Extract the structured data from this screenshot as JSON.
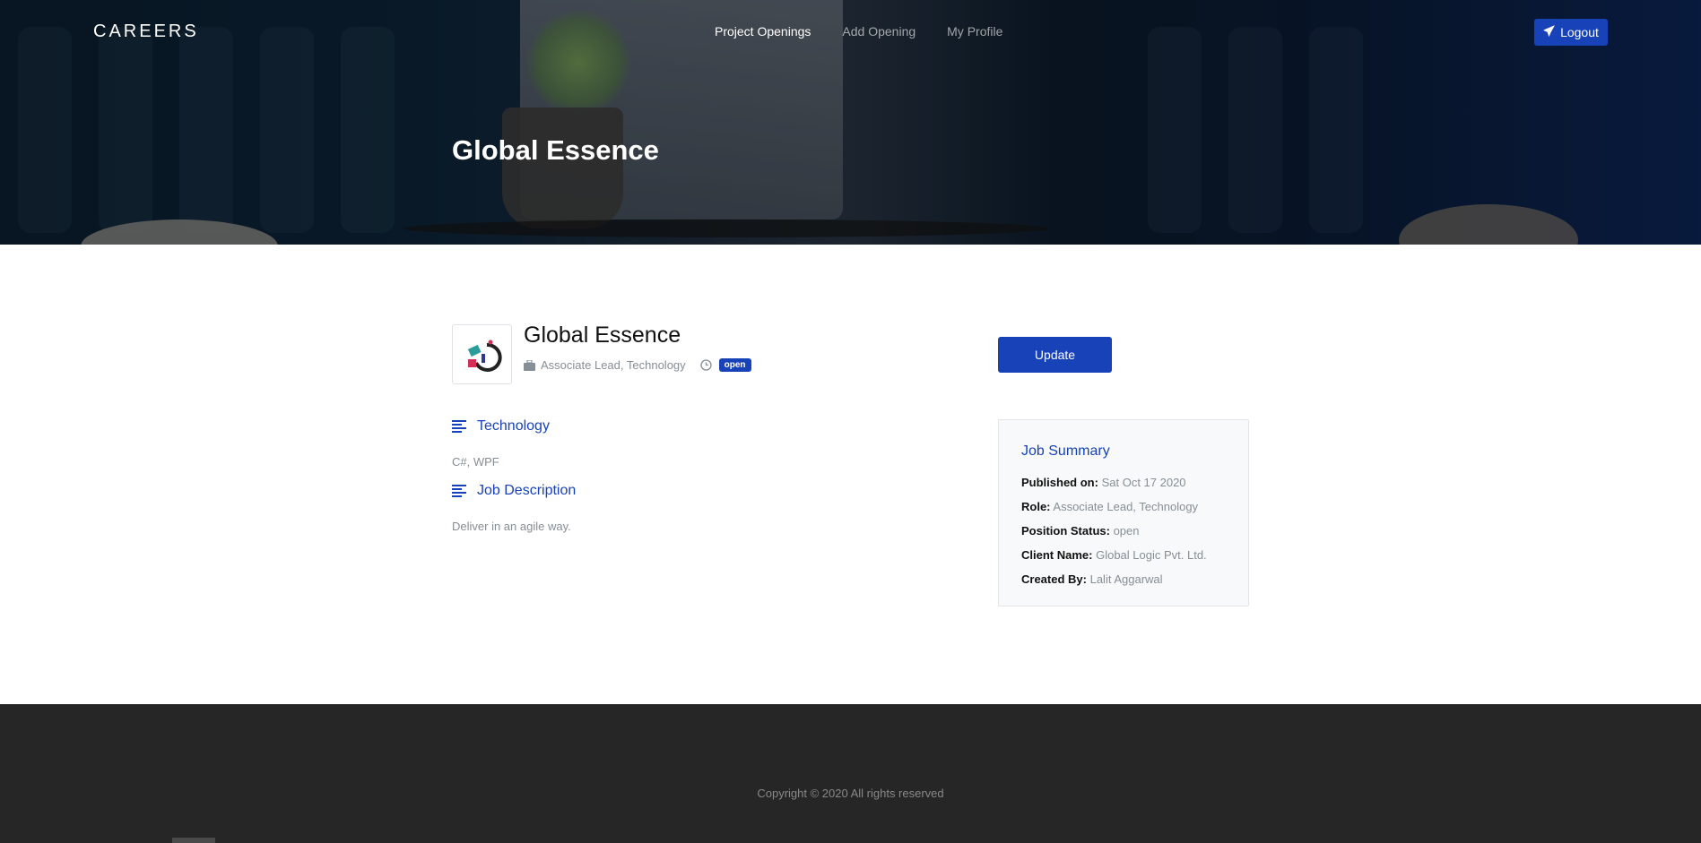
{
  "header": {
    "brand": "CAREERS",
    "nav": [
      {
        "label": "Project Openings",
        "active": true
      },
      {
        "label": "Add Opening",
        "active": false
      },
      {
        "label": "My Profile",
        "active": false
      }
    ],
    "logout_label": "Logout",
    "hero_title": "Global Essence"
  },
  "job": {
    "title": "Global Essence",
    "role": "Associate Lead, Technology",
    "status_badge": "open",
    "sections": [
      {
        "heading": "Technology",
        "text": "C#, WPF"
      },
      {
        "heading": "Job Description",
        "text": "Deliver in an agile way."
      }
    ]
  },
  "actions": {
    "update_label": "Update"
  },
  "summary": {
    "title": "Job Summary",
    "rows": [
      {
        "label": "Published on:",
        "value": "Sat Oct 17 2020"
      },
      {
        "label": "Role:",
        "value": "Associate Lead, Technology"
      },
      {
        "label": "Position Status:",
        "value": "open"
      },
      {
        "label": "Client Name:",
        "value": "Global Logic Pvt. Ltd."
      },
      {
        "label": "Created By:",
        "value": "Lalit Aggarwal"
      }
    ]
  },
  "footer": {
    "copyright": "Copyright © 2020 All rights reserved"
  },
  "colors": {
    "accent": "#1742b8",
    "footer_bg": "#262626"
  },
  "icons": [
    "paper-plane-icon",
    "briefcase-icon",
    "clock-icon",
    "align-left-icon",
    "company-logo"
  ]
}
